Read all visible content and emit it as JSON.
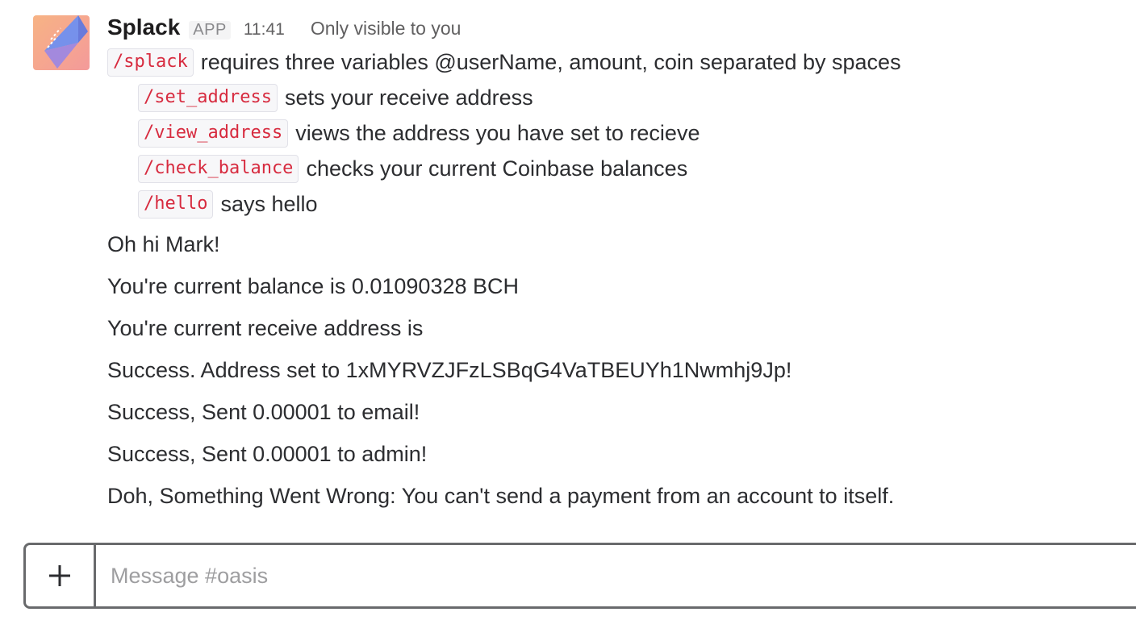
{
  "message": {
    "sender": "Splack",
    "badge": "APP",
    "time": "11:41",
    "visibility": "Only visible to you",
    "commands": [
      {
        "command": "/splack",
        "description": "requires three variables @userName, amount, coin separated by spaces"
      },
      {
        "command": "/set_address",
        "description": "sets your receive address"
      },
      {
        "command": "/view_address",
        "description": "views the address you have set to recieve"
      },
      {
        "command": "/check_balance",
        "description": "checks your current Coinbase balances"
      },
      {
        "command": "/hello",
        "description": "says hello"
      }
    ],
    "lines": [
      "Oh hi Mark!",
      "You're current balance is 0.01090328 BCH",
      "You're current receive address is",
      "Success. Address set to 1xMYRVZJFzLSBqG4VaTBEUYh1Nwmhj9Jp!",
      "Success, Sent 0.00001 to email!",
      "Success, Sent 0.00001 to admin!",
      "Doh, Something Went Wrong: You can't send a payment from an account to itself."
    ]
  },
  "composer": {
    "placeholder": "Message #oasis",
    "add_icon": "plus-icon"
  },
  "avatar": {
    "icon": "splack-logo",
    "colors": {
      "background": "#f6a68a",
      "accent": "#6b8cf0"
    }
  }
}
